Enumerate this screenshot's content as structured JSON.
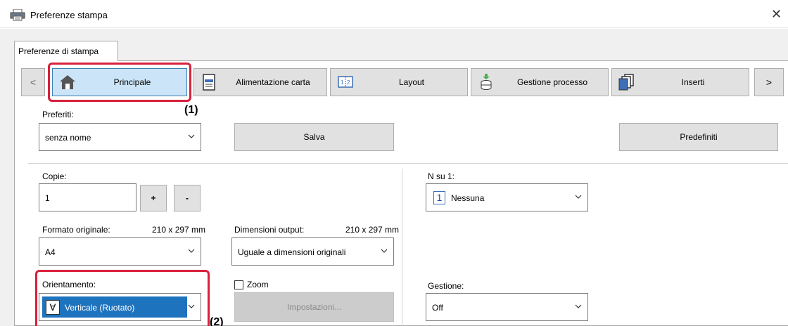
{
  "window": {
    "title": "Preferenze stampa",
    "close_glyph": "✕"
  },
  "tabs": [
    {
      "label": "Preferenze di stampa"
    }
  ],
  "toolbar": {
    "prev_glyph": "<",
    "next_glyph": ">",
    "buttons": [
      {
        "label": "Principale",
        "icon": "home-icon",
        "selected": true
      },
      {
        "label": "Alimentazione carta",
        "icon": "paper-tray-icon"
      },
      {
        "label": "Layout",
        "icon": "layout-icon"
      },
      {
        "label": "Gestione processo",
        "icon": "job-handling-icon"
      },
      {
        "label": "Inserti",
        "icon": "inserts-icon"
      }
    ]
  },
  "callouts": {
    "one": "(1)",
    "two": "(2)"
  },
  "favorites": {
    "label": "Preferiti:",
    "value": "senza nome",
    "save_label": "Salva",
    "defaults_label": "Predefiniti"
  },
  "copies": {
    "label": "Copie:",
    "value": "1",
    "plus": "+",
    "minus": "-"
  },
  "original_size": {
    "label": "Formato originale:",
    "dims": "210 x 297 mm",
    "value": "A4"
  },
  "output_size": {
    "label": "Dimensioni output:",
    "dims": "210 x 297 mm",
    "value": "Uguale a dimensioni originali"
  },
  "orientation": {
    "label": "Orientamento:",
    "value": "Verticale (Ruotato)",
    "glyph": "∀"
  },
  "zoom": {
    "label": "Zoom",
    "checked": false,
    "settings_label": "Impostazioni..."
  },
  "n_up": {
    "label": "N su 1:",
    "glyph": "1",
    "value": "Nessuna"
  },
  "handling": {
    "label": "Gestione:",
    "value": "Off"
  },
  "colors": {
    "accent": "#d8203c",
    "selected_bg": "#cce4f7",
    "dropdown_selected": "#1e73be"
  }
}
